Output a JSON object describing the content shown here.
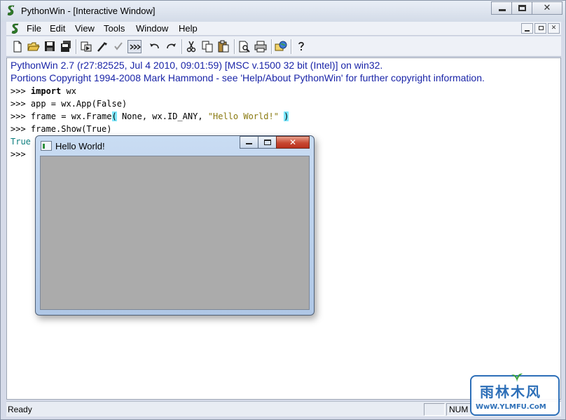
{
  "app": {
    "title": "PythonWin - [Interactive Window]"
  },
  "menu": {
    "items": [
      "File",
      "Edit",
      "View",
      "Tools",
      "Window",
      "Help"
    ]
  },
  "toolbar": {
    "buttons": [
      "new-file-icon",
      "open-folder-icon",
      "save-icon",
      "save-all-icon",
      "run-script-icon",
      "debug-icon",
      "checkmark-icon",
      "indent-icon",
      "undo-icon",
      "redo-icon",
      "cut-icon",
      "copy-icon",
      "paste-icon",
      "print-preview-icon",
      "print-icon",
      "browse-icon",
      "help-icon"
    ]
  },
  "interactive": {
    "banner1": "PythonWin 2.7 (r27:82525, Jul  4 2010, 09:01:59) [MSC v.1500 32 bit (Intel)] on win32.",
    "banner2": "Portions Copyright 1994-2008 Mark Hammond - see 'Help/About PythonWin' for further copyright information.",
    "prompt": ">>> ",
    "lines": [
      {
        "kw": "import",
        "rest": " wx"
      },
      {
        "text": "app = wx.App(False)"
      },
      {
        "pre": "frame = wx.Frame",
        "open": "(",
        "mid": " None, wx.ID_ANY, ",
        "str": "\"Hello World!\"",
        "tail": " ",
        "close": ")"
      },
      {
        "text": "frame.Show(True)"
      }
    ],
    "output": "True",
    "last_prompt": ">>>"
  },
  "child_window": {
    "title": "Hello World!",
    "close_glyph": "✕"
  },
  "statusbar": {
    "text": "Ready",
    "num": "NUM"
  },
  "watermark": {
    "cn": "雨林木风",
    "url": "WwW.YLMFU.CoM"
  },
  "colors": {
    "banner": "#1a25a8",
    "string": "#8a7a10",
    "output": "#0f7f7f",
    "paren_highlight": "#7fe8ff",
    "client_area": "#ababab"
  }
}
